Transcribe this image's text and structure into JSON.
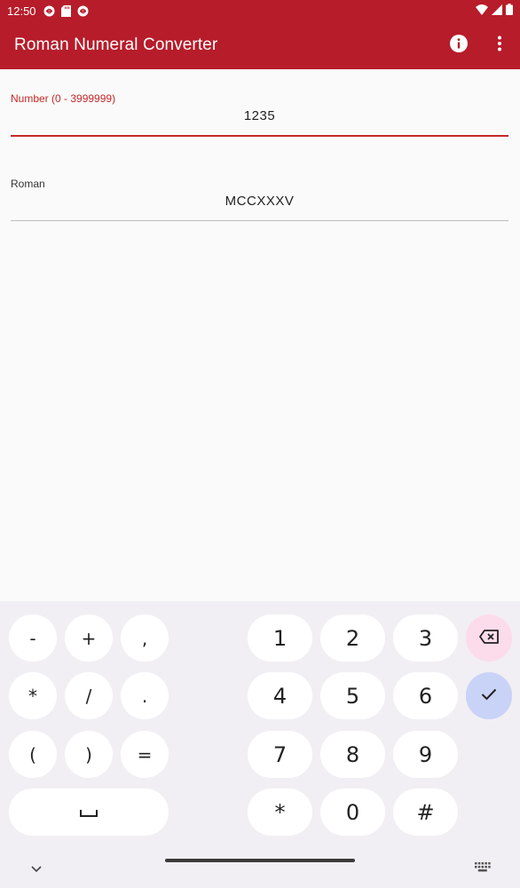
{
  "status_bar": {
    "time": "12:50",
    "left_icons": [
      "vpn-key-icon",
      "sd-card-icon",
      "vpn-key-icon"
    ],
    "right_icons": [
      "wifi-icon",
      "cell-signal-icon",
      "battery-icon"
    ]
  },
  "app_bar": {
    "title": "Roman Numeral Converter",
    "actions": [
      "info-icon",
      "more-vert-icon"
    ]
  },
  "number_field": {
    "label": "Number (0 - 3999999)",
    "value": "1235"
  },
  "roman_field": {
    "label": "Roman",
    "value": "MCCXXXV"
  },
  "keyboard": {
    "symbol_keys": [
      "-",
      "+",
      ",",
      "*",
      "/",
      ".",
      "(",
      ")",
      "="
    ],
    "space_icon": "space-bar-icon",
    "number_keys": [
      "1",
      "2",
      "3",
      "4",
      "5",
      "6",
      "7",
      "8",
      "9",
      "*",
      "0",
      "#"
    ],
    "action_icons": [
      "backspace-icon",
      "check-icon"
    ],
    "bottom_icons": [
      "chevron-down-icon",
      "keyboard-icon"
    ]
  },
  "colors": {
    "primary": "#b71c2a",
    "accent_label": "#c62828",
    "keyboard_bg": "#f1eff4",
    "delete_key": "#fcdcea",
    "done_key": "#c9d3f7"
  }
}
